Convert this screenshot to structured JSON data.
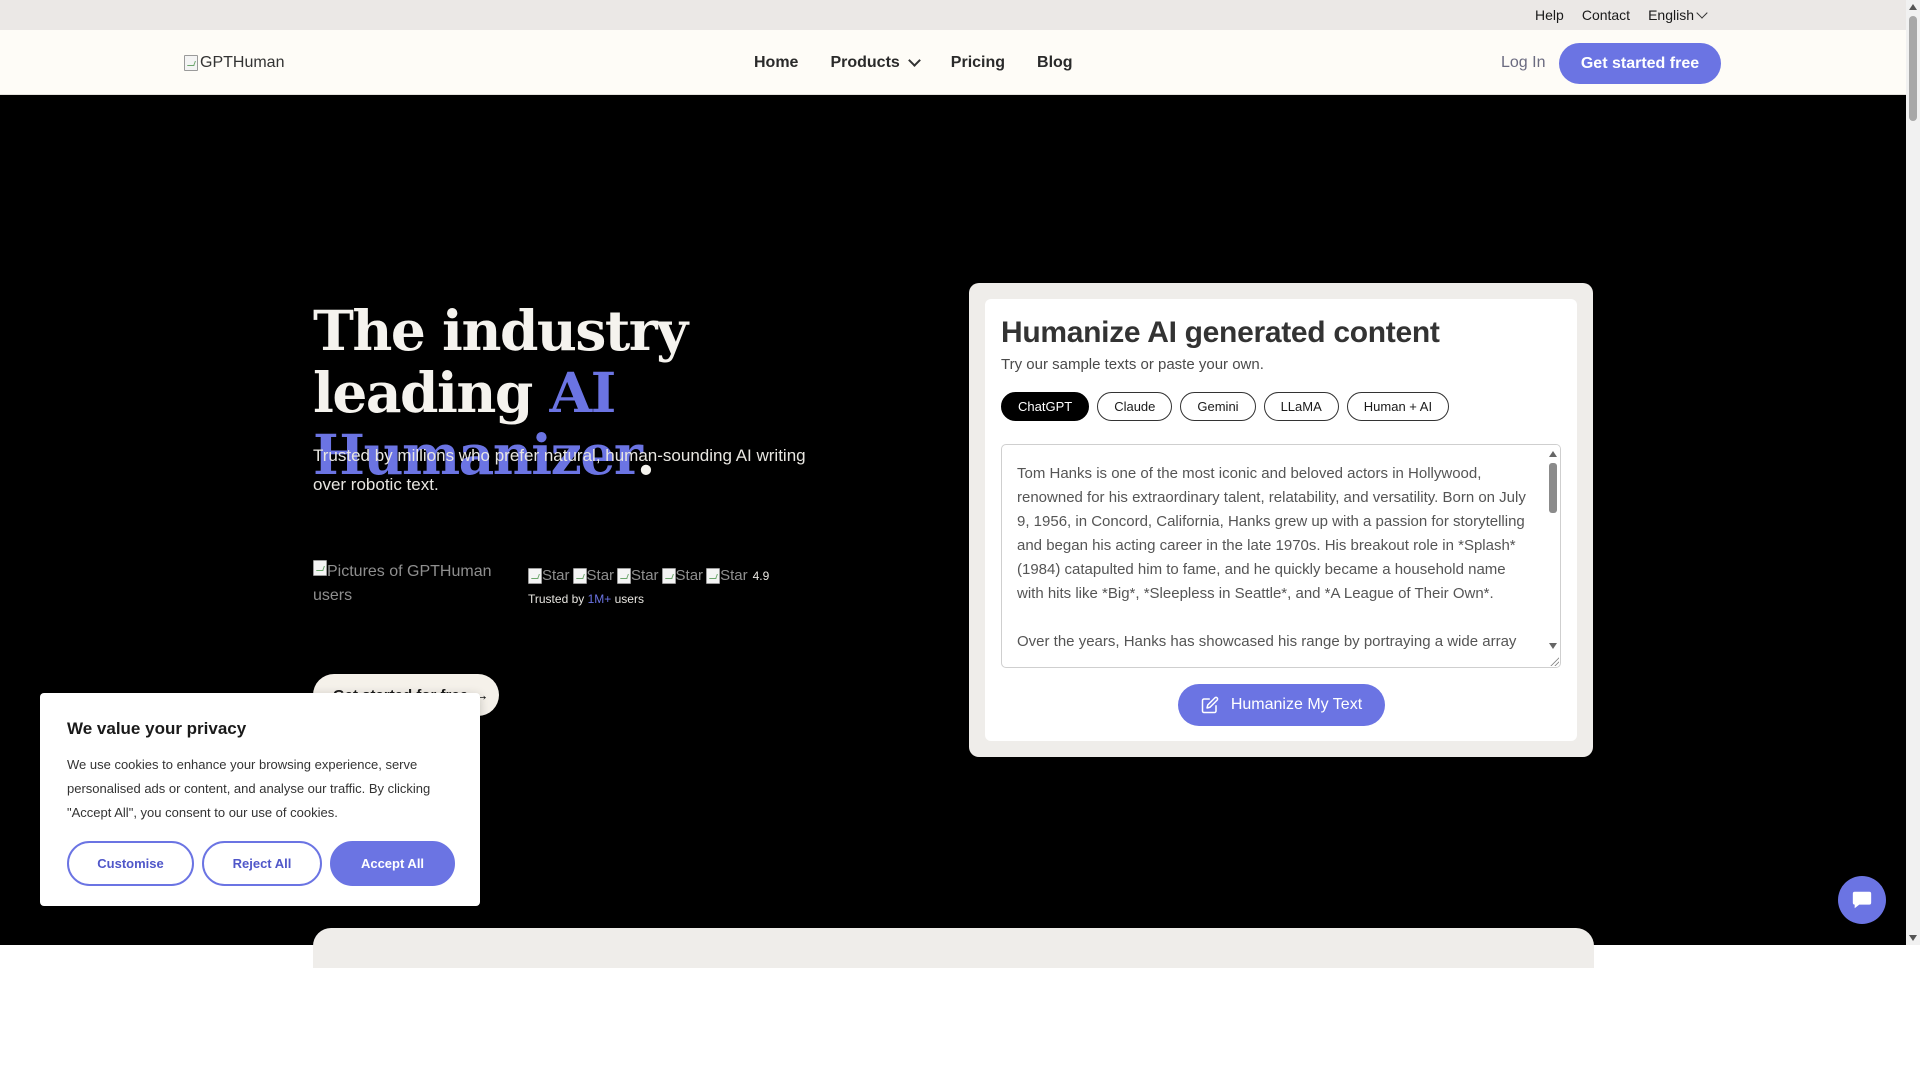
{
  "topbar": {
    "help": "Help",
    "contact": "Contact",
    "language": "English"
  },
  "nav": {
    "logo_alt": "GPTHuman",
    "home": "Home",
    "products": "Products",
    "pricing": "Pricing",
    "blog": "Blog",
    "login": "Log In",
    "cta": "Get started free"
  },
  "hero": {
    "title_part1": "The industry leading ",
    "title_accent1": "AI",
    "title_accent2": "Humanizer",
    "title_end": ".",
    "subtitle": "Trusted by millions who prefer natural, human-sounding AI writing over robotic text.",
    "users_img_alt": "Pictures of GPTHuman users",
    "star_alt": "Star",
    "rating": "4.9",
    "trusted_prefix": "Trusted by ",
    "trusted_count": "1M+",
    "trusted_suffix": " users",
    "cta": "Get started for free"
  },
  "demo": {
    "title": "Humanize AI generated content",
    "subtitle": "Try our sample texts or paste your own.",
    "chips": [
      "ChatGPT",
      "Claude",
      "Gemini",
      "LLaMA",
      "Human + AI"
    ],
    "active_chip": "ChatGPT",
    "sample_text": "Tom Hanks is one of the most iconic and beloved actors in Hollywood, renowned for his extraordinary talent, relatability, and versatility. Born on July 9, 1956, in Concord, California, Hanks grew up with a passion for storytelling and began his acting career in the late 1970s. His breakout role in *Splash* (1984) catapulted him to fame, and he quickly became a household name with hits like *Big*, *Sleepless in Seattle*, and *A League of Their Own*.\n\nOver the years, Hanks has showcased his range by portraying a wide array",
    "button": "Humanize My Text"
  },
  "cookie": {
    "title": "We value your privacy",
    "text": "We use cookies to enhance your browsing experience, serve personalised ads or content, and analyse our traffic. By clicking \"Accept All\", you consent to our use of cookies.",
    "customise": "Customise",
    "reject": "Reject All",
    "accept": "Accept All"
  },
  "colors": {
    "accent": "#6b74e3",
    "hero_bg": "#000000",
    "nav_bg": "#fefcf7",
    "topbar_bg": "#ebe8e6"
  }
}
